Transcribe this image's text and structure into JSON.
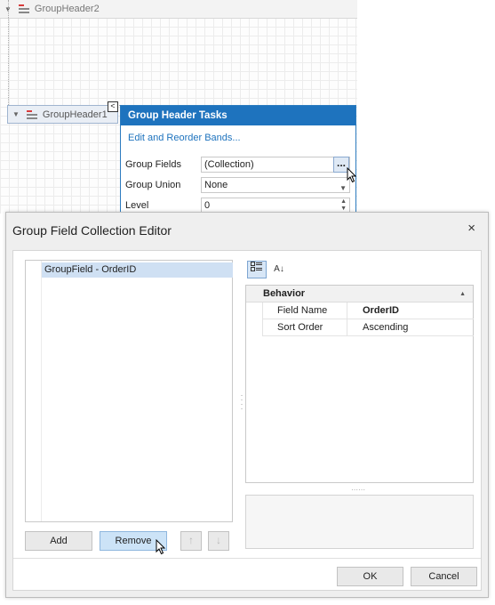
{
  "designer": {
    "band_top_label": "GroupHeader2",
    "band_selected_label": "GroupHeader1",
    "smart_tag_glyph": "<"
  },
  "tasks_panel": {
    "title": "Group Header Tasks",
    "link": "Edit and Reorder Bands...",
    "fields": [
      {
        "label": "Group Fields",
        "value": "(Collection)"
      },
      {
        "label": "Group Union",
        "value": "None"
      },
      {
        "label": "Level",
        "value": "0"
      }
    ],
    "ellipsis_glyph": "...",
    "colors": {
      "header": "#1e73be",
      "link": "#1e73be"
    }
  },
  "dialog": {
    "title": "Group Field Collection Editor",
    "close_glyph": "×",
    "list_items": [
      "GroupField - OrderID"
    ],
    "buttons": {
      "add": "Add",
      "remove": "Remove",
      "move_up": "↑",
      "move_down": "↓",
      "ok": "OK",
      "cancel": "Cancel"
    },
    "toolbar": {
      "categorized_icon": "categorized-icon",
      "alphabetical_icon": "sort-az-icon",
      "alphabetical_glyph": "A↓"
    },
    "property_grid": {
      "category": "Behavior",
      "rows": [
        {
          "name": "Field Name",
          "value": "OrderID"
        },
        {
          "name": "Sort Order",
          "value": "Ascending"
        }
      ]
    },
    "colors": {
      "selection": "#cfe0f3",
      "hover_button": "#cce3f7"
    }
  }
}
